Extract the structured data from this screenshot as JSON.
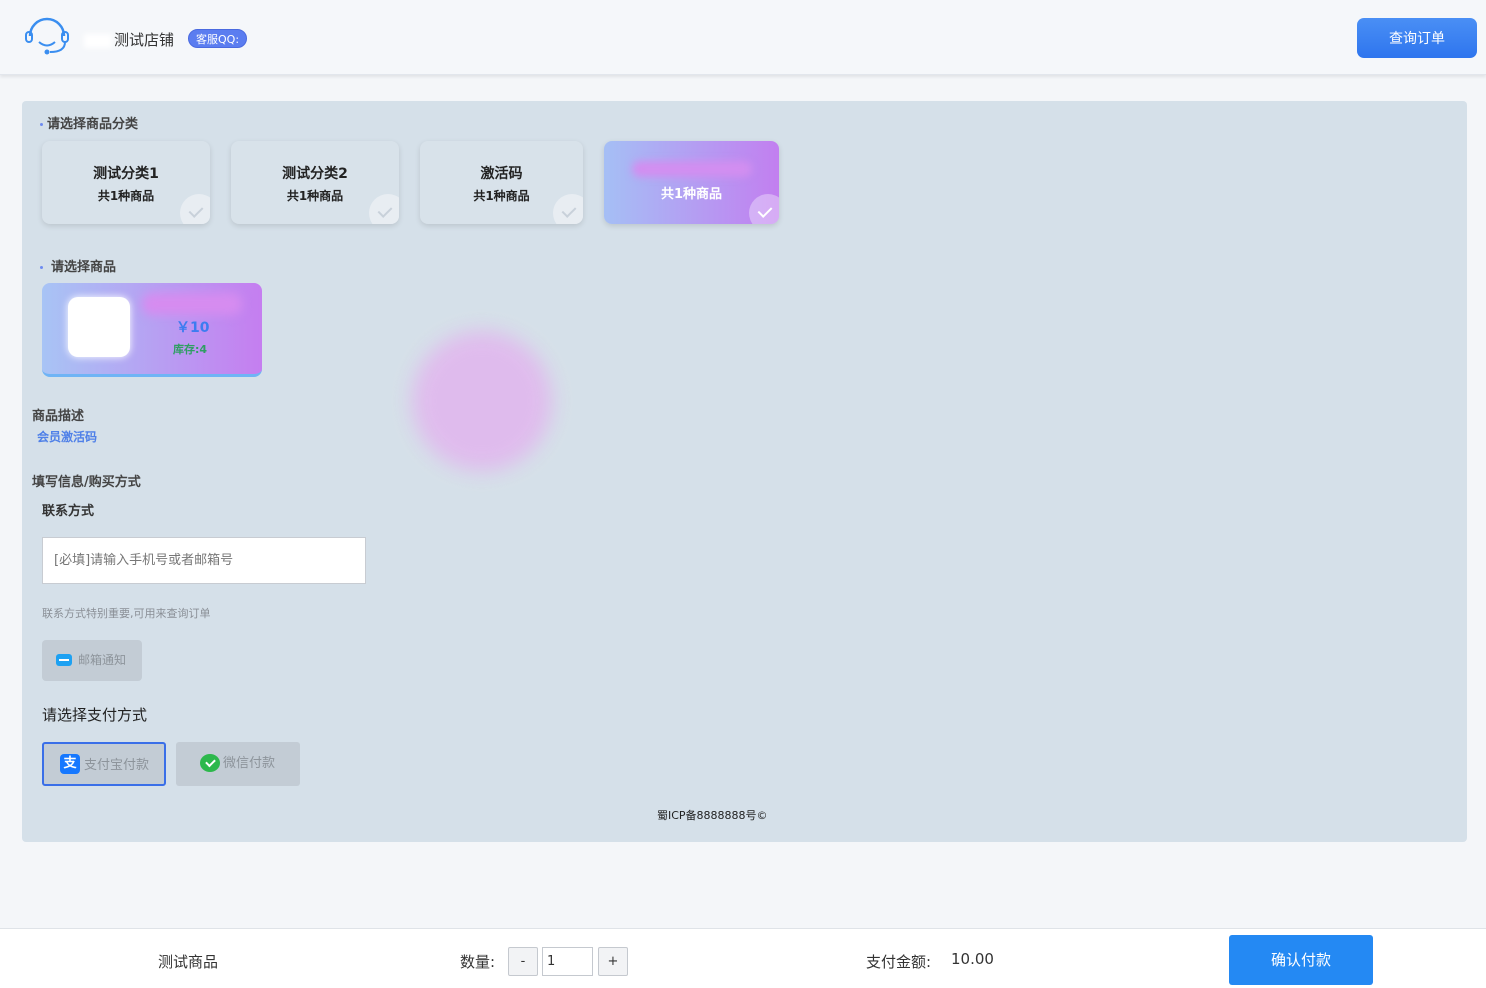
{
  "header": {
    "shop_name": "测试店铺",
    "qq_badge": "客服QQ:",
    "query_button": "查询订单"
  },
  "categories": {
    "title": "请选择商品分类",
    "items": [
      {
        "name": "测试分类1",
        "count": "共1种商品"
      },
      {
        "name": "测试分类2",
        "count": "共1种商品"
      },
      {
        "name": "激活码",
        "count": "共1种商品"
      },
      {
        "name": "",
        "count": "共1种商品"
      }
    ]
  },
  "products": {
    "title": "请选择商品",
    "items": [
      {
        "price": "￥10",
        "stock": "库存:4"
      }
    ]
  },
  "description": {
    "label": "商品描述",
    "text": "会员激活码"
  },
  "form": {
    "section_label": "填写信息/购买方式",
    "contact_label": "联系方式",
    "contact_placeholder": "[必填]请输入手机号或者邮箱号",
    "contact_hint": "联系方式特别重要,可用来查询订单",
    "email_notify": "邮箱通知",
    "pay_label": "请选择支付方式",
    "alipay": "支付宝付款",
    "alipay_icon_char": "支",
    "wechat": "微信付款"
  },
  "icp": "蜀ICP备8888888号©",
  "footer": {
    "product_name": "测试商品",
    "qty_label": "数量:",
    "qty_minus": "-",
    "qty_value": "1",
    "qty_plus": "+",
    "amount_label": "支付金额:",
    "amount": "10.00",
    "confirm_button": "确认付款"
  },
  "colors": {
    "accent": "#2489f3",
    "panel_bg": "#d5e0e9",
    "active_gradient_start": "#a5bff5",
    "active_gradient_end": "#c27ff0"
  },
  "icons": [
    "headset-icon",
    "check-icon",
    "email-icon",
    "alipay-icon",
    "wechat-icon"
  ]
}
